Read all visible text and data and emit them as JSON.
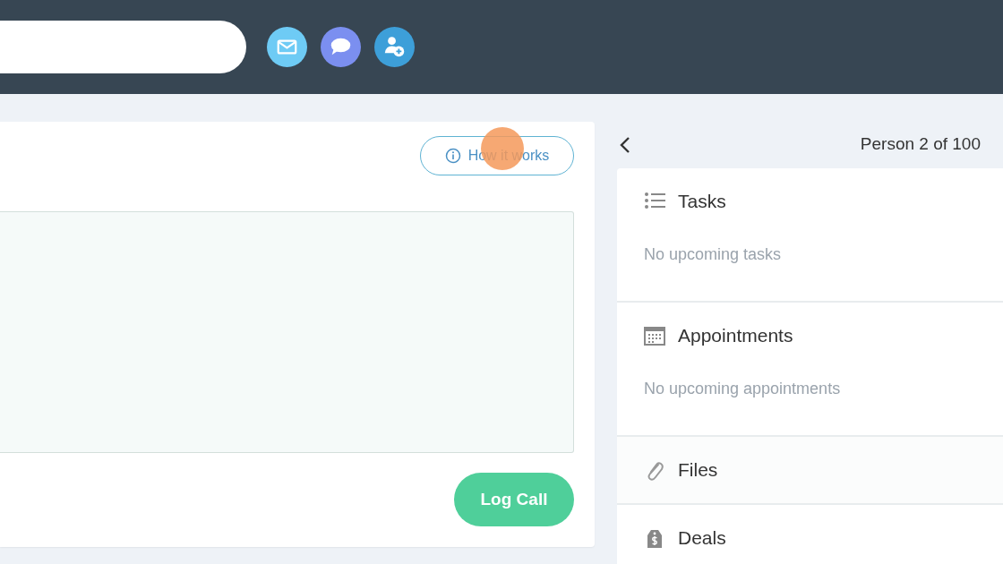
{
  "header": {
    "actions": [
      {
        "kind": "email"
      },
      {
        "kind": "chat"
      },
      {
        "kind": "add-person"
      }
    ]
  },
  "call_panel": {
    "help_button": "How it works",
    "submit_button": "Log Call"
  },
  "record_nav": {
    "position": "Person 2 of 100"
  },
  "sections": [
    {
      "kind": "tasks",
      "title": "Tasks",
      "empty_text": "No upcoming tasks"
    },
    {
      "kind": "appointments",
      "title": "Appointments",
      "empty_text": "No upcoming appointments"
    },
    {
      "kind": "files",
      "title": "Files"
    },
    {
      "kind": "deals",
      "title": "Deals"
    }
  ]
}
